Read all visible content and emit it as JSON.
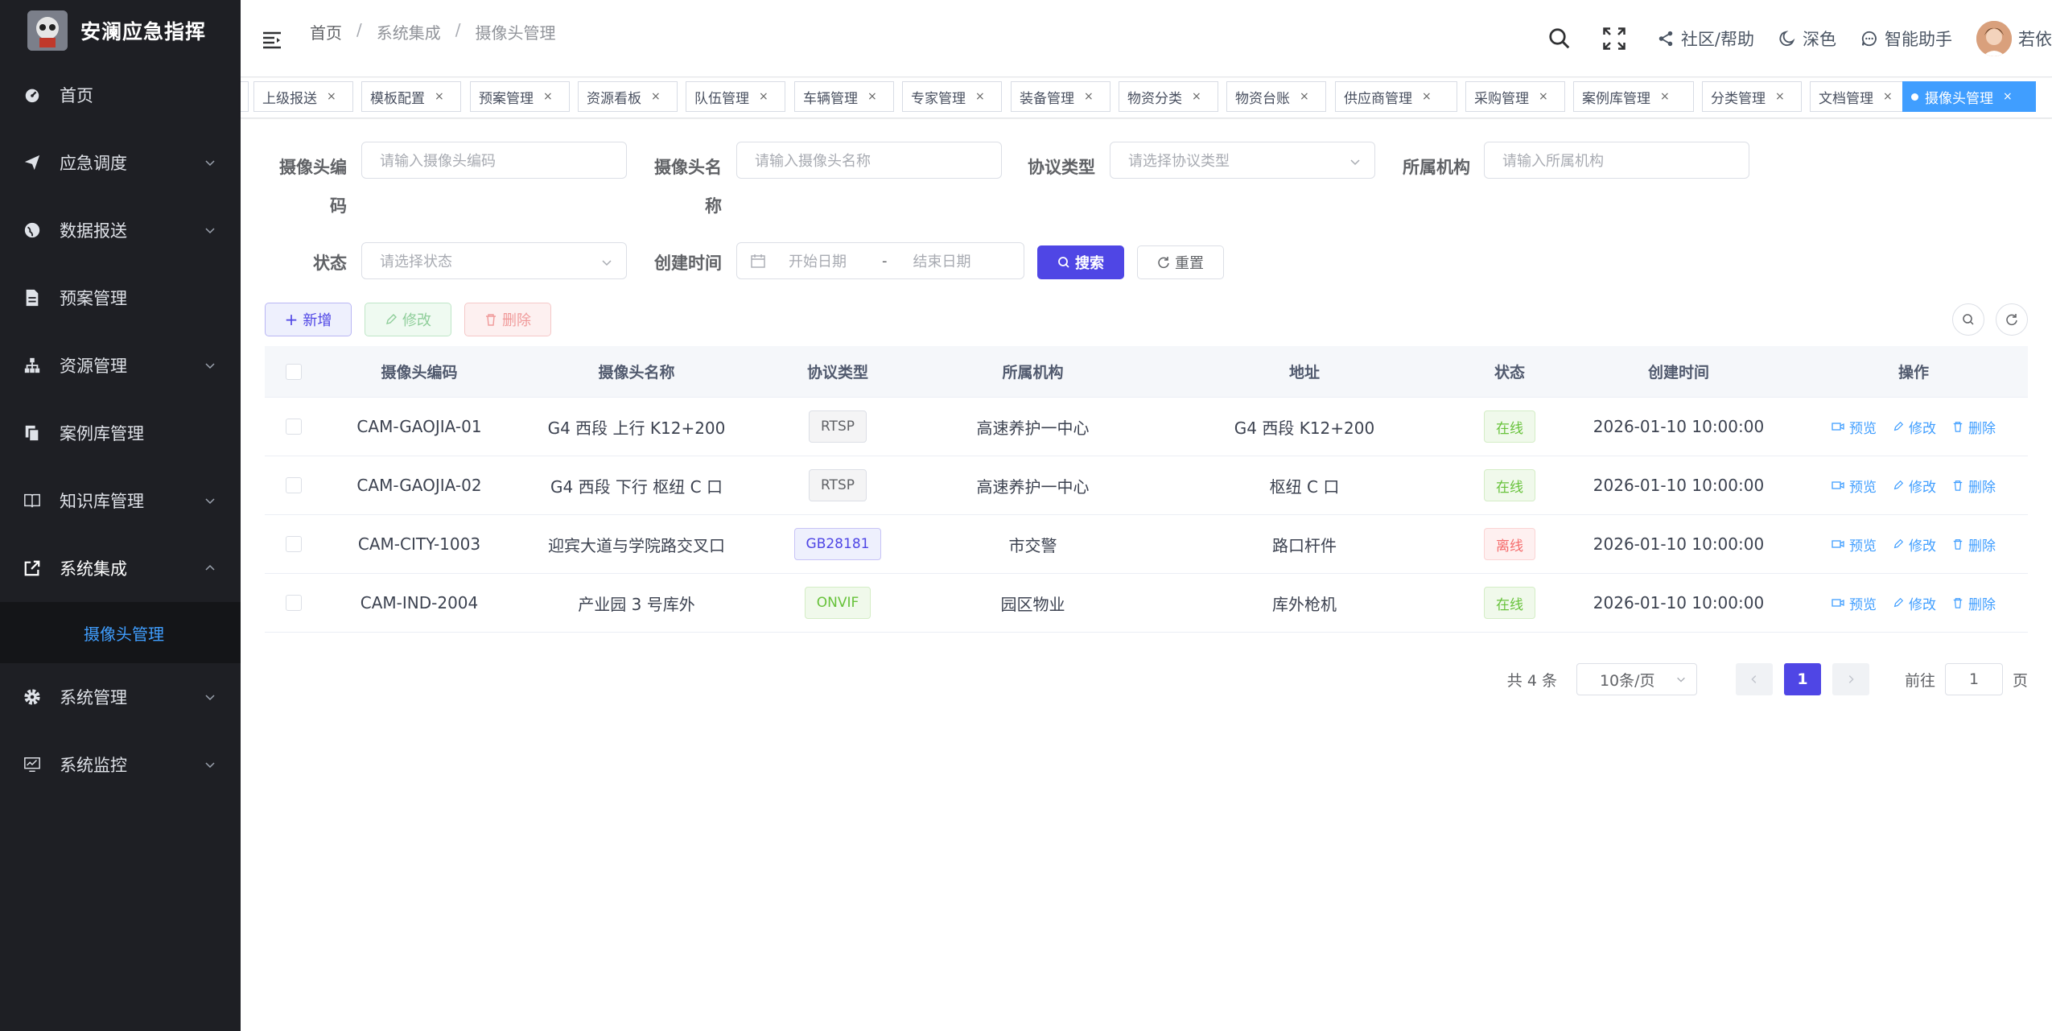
{
  "app": {
    "title": "安澜应急指挥"
  },
  "sidebar": {
    "items": [
      {
        "label": "首页",
        "icon": "dashboard-icon"
      },
      {
        "label": "应急调度",
        "icon": "send-icon"
      },
      {
        "label": "数据报送",
        "icon": "globe-icon"
      },
      {
        "label": "预案管理",
        "icon": "document-icon"
      },
      {
        "label": "资源管理",
        "icon": "tree-icon"
      },
      {
        "label": "案例库管理",
        "icon": "copy-icon"
      },
      {
        "label": "知识库管理",
        "icon": "book-icon"
      },
      {
        "label": "系统集成",
        "icon": "external-link-icon"
      },
      {
        "label": "系统管理",
        "icon": "gear-icon"
      },
      {
        "label": "系统监控",
        "icon": "monitor-icon"
      }
    ],
    "sub_active": "摄像头管理"
  },
  "header": {
    "breadcrumb": [
      "首页",
      "系统集成",
      "摄像头管理"
    ],
    "community": "社区/帮助",
    "theme": "深色",
    "assistant": "智能助手",
    "user": "若依"
  },
  "tags": [
    "上级报送",
    "模板配置",
    "预案管理",
    "资源看板",
    "队伍管理",
    "车辆管理",
    "专家管理",
    "装备管理",
    "物资分类",
    "物资台账",
    "供应商管理",
    "采购管理",
    "案例库管理",
    "分类管理",
    "文档管理",
    "摄像头管理"
  ],
  "form": {
    "code_label_1": "摄像头编",
    "code_label_2": "码",
    "code_placeholder": "请输入摄像头编码",
    "name_label_1": "摄像头名",
    "name_label_2": "称",
    "name_placeholder": "请输入摄像头名称",
    "protocol_label": "协议类型",
    "protocol_placeholder": "请选择协议类型",
    "org_label": "所属机构",
    "org_placeholder": "请输入所属机构",
    "status_label": "状态",
    "status_placeholder": "请选择状态",
    "time_label": "创建时间",
    "start_placeholder": "开始日期",
    "dash": "-",
    "end_placeholder": "结束日期",
    "search": "搜索",
    "reset": "重置"
  },
  "toolbar": {
    "add": "新增",
    "edit": "修改",
    "delete": "删除"
  },
  "table": {
    "headers": [
      "摄像头编码",
      "摄像头名称",
      "协议类型",
      "所属机构",
      "地址",
      "状态",
      "创建时间",
      "操作"
    ],
    "rows": [
      {
        "code": "CAM-GAOJIA-01",
        "name": "G4 西段 上行 K12+200",
        "protocol": "RTSP",
        "org": "高速养护一中心",
        "address": "G4 西段 K12+200",
        "status": "在线",
        "time": "2026-01-10 10:00:00"
      },
      {
        "code": "CAM-GAOJIA-02",
        "name": "G4 西段 下行 枢纽 C 口",
        "protocol": "RTSP",
        "org": "高速养护一中心",
        "address": "枢纽 C 口",
        "status": "在线",
        "time": "2026-01-10 10:00:00"
      },
      {
        "code": "CAM-CITY-1003",
        "name": "迎宾大道与学院路交叉口",
        "protocol": "GB28181",
        "org": "市交警",
        "address": "路口杆件",
        "status": "离线",
        "time": "2026-01-10 10:00:00"
      },
      {
        "code": "CAM-IND-2004",
        "name": "产业园 3 号库外",
        "protocol": "ONVIF",
        "org": "园区物业",
        "address": "库外枪机",
        "status": "在线",
        "time": "2026-01-10 10:00:00"
      }
    ],
    "ops": [
      "预览",
      "修改",
      "删除"
    ]
  },
  "pagination": {
    "total": "共 4 条",
    "page_size": "10条/页",
    "current": "1",
    "goto": "前往",
    "goto_value": "1",
    "page_unit": "页"
  },
  "colors": {
    "primary": "#4f46e5",
    "link": "#409eff",
    "sidebar": "#1e1f24"
  }
}
